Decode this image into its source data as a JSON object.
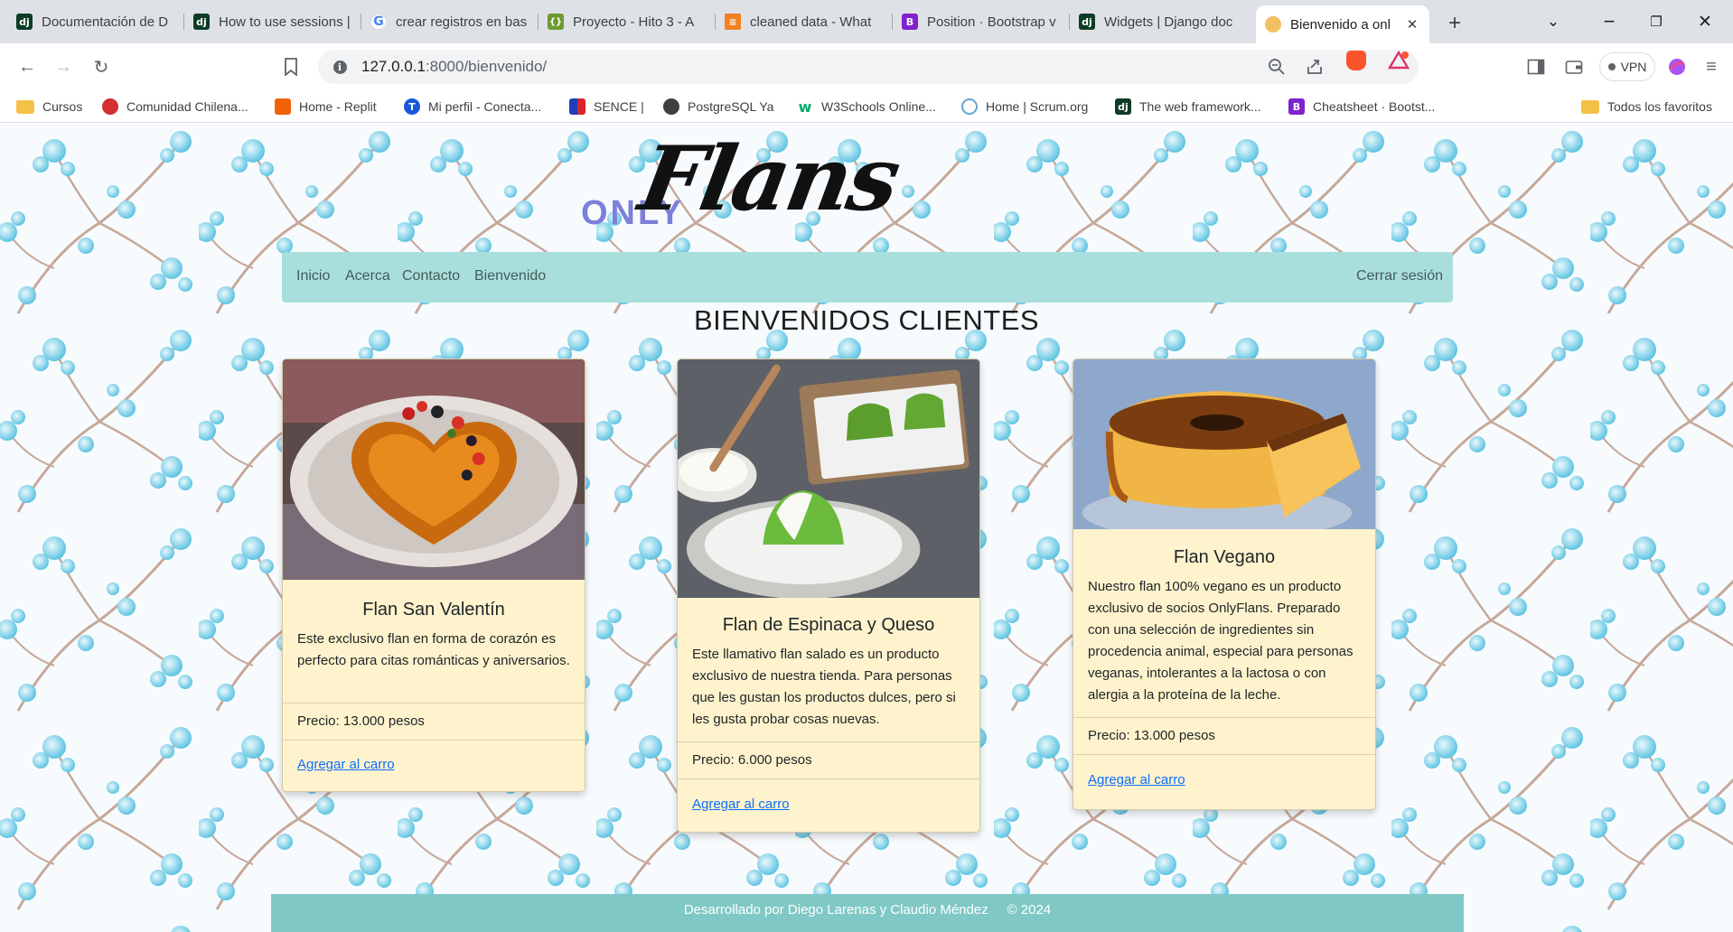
{
  "browser": {
    "tabs": [
      {
        "label": "Documentación de D",
        "favicon": "django-icon"
      },
      {
        "label": "How to use sessions |",
        "favicon": "django-icon"
      },
      {
        "label": "crear registros en bas",
        "favicon": "google-icon"
      },
      {
        "label": "Proyecto - Hito 3 - A",
        "favicon": "project-icon"
      },
      {
        "label": "cleaned data - What",
        "favicon": "stackoverflow-icon"
      },
      {
        "label": "Position · Bootstrap v",
        "favicon": "bootstrap-icon"
      },
      {
        "label": "Widgets | Django doc",
        "favicon": "django-icon"
      },
      {
        "label": "Bienvenido a onl",
        "favicon": "flan-icon",
        "active": true
      }
    ],
    "url_host": "127.0.0.1",
    "url_path": ":8000/bienvenido/",
    "vpn_label": "VPN",
    "bookmarks": [
      {
        "label": "Cursos",
        "icon": "folder-icon"
      },
      {
        "label": "Comunidad Chilena...",
        "icon": "community-icon"
      },
      {
        "label": "Home - Replit",
        "icon": "replit-icon"
      },
      {
        "label": "Mi perfil - Conecta...",
        "icon": "profile-icon"
      },
      {
        "label": "SENCE |",
        "icon": "sence-icon"
      },
      {
        "label": "PostgreSQL Ya",
        "icon": "globe-icon"
      },
      {
        "label": "W3Schools Online...",
        "icon": "w3schools-icon"
      },
      {
        "label": "Home | Scrum.org",
        "icon": "scrum-icon"
      },
      {
        "label": "The web framework...",
        "icon": "django-icon"
      },
      {
        "label": "Cheatsheet · Bootst...",
        "icon": "bootstrap-icon"
      }
    ],
    "all_bookmarks": "Todos los favoritos"
  },
  "site": {
    "logo_only": "ONLY",
    "logo_flans": "Flans",
    "nav": [
      "Inicio",
      "Acerca",
      "Contacto",
      "Bienvenido"
    ],
    "logout": "Cerrar sesión",
    "heading": "BIENVENIDOS CLIENTES",
    "products": [
      {
        "title": "Flan San Valentín",
        "description": "Este exclusivo flan en forma de corazón es perfecto para citas románticas y aniversarios.",
        "price": "Precio: 13.000 pesos",
        "cta": "Agregar al carro",
        "image": "heart-shaped caramel flan with strawberries"
      },
      {
        "title": "Flan de Espinaca y Queso",
        "description": "Este llamativo flan salado es un producto exclusivo de nuestra tienda. Para personas que les gustan los productos dulces, pero si les gusta probar cosas nuevas.",
        "price": "Precio: 6.000 pesos",
        "cta": "Agregar al carro",
        "image": "green spinach flan with cream sauce"
      },
      {
        "title": "Flan Vegano",
        "description": "Nuestro flan 100% vegano es un producto exclusivo de socios OnlyFlans. Preparado con una selección de ingredientes sin procedencia animal, especial para personas veganas, intolerantes a la lactosa o con alergia a la proteína de la leche.",
        "price": "Precio: 13.000 pesos",
        "cta": "Agregar al carro",
        "image": "round caramel flan with a slice cut"
      }
    ],
    "footer": "Desarrollado por Diego Larenas y Claudio Méndez     © 2024"
  },
  "colors": {
    "nav_bg": "#a8dfdd",
    "card_bg": "#fff3cd",
    "footer_bg": "#7fc8c5",
    "link": "#0d6efd",
    "logo_only": "#7d7fd8"
  }
}
